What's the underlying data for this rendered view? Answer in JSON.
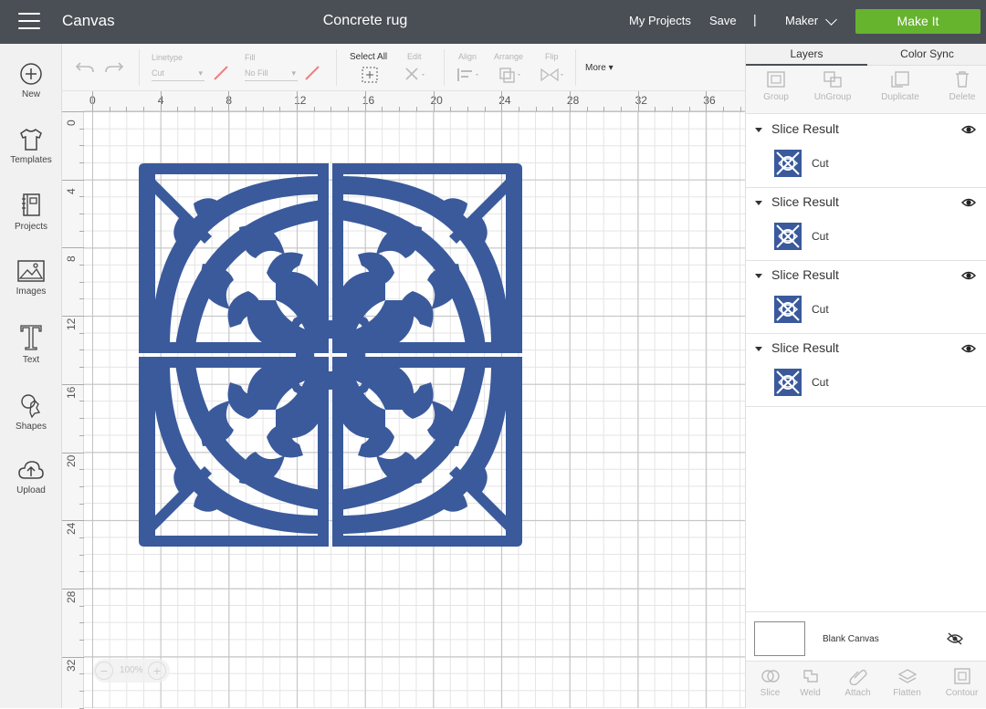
{
  "topbar": {
    "app_title": "Canvas",
    "doc_title": "Concrete rug",
    "my_projects": "My Projects",
    "save": "Save",
    "separator": "|",
    "machine": "Maker",
    "make_it": "Make It"
  },
  "sidebar": {
    "items": [
      {
        "label": "New",
        "icon": "plus-circle-icon"
      },
      {
        "label": "Templates",
        "icon": "tshirt-icon"
      },
      {
        "label": "Projects",
        "icon": "book-icon"
      },
      {
        "label": "Images",
        "icon": "image-icon"
      },
      {
        "label": "Text",
        "icon": "text-icon"
      },
      {
        "label": "Shapes",
        "icon": "shapes-icon"
      },
      {
        "label": "Upload",
        "icon": "cloud-upload-icon"
      }
    ]
  },
  "toolbar": {
    "linetype_label": "Linetype",
    "linetype_value": "Cut",
    "fill_label": "Fill",
    "fill_value": "No Fill",
    "select_all": "Select All",
    "edit": "Edit",
    "align": "Align",
    "arrange": "Arrange",
    "flip": "Flip",
    "more": "More"
  },
  "ruler": {
    "top": [
      "0",
      "4",
      "8",
      "12",
      "16",
      "20",
      "24",
      "28",
      "32",
      "36"
    ],
    "left": [
      "0",
      "4",
      "8",
      "12",
      "16",
      "20",
      "24",
      "28",
      "32"
    ]
  },
  "canvas": {
    "zoom": "100%",
    "design_color": "#3a5a9c"
  },
  "layers_panel": {
    "tabs": [
      "Layers",
      "Color Sync"
    ],
    "actions": [
      "Group",
      "UnGroup",
      "Duplicate",
      "Delete"
    ],
    "groups": [
      {
        "title": "Slice Result",
        "item": "Cut"
      },
      {
        "title": "Slice Result",
        "item": "Cut"
      },
      {
        "title": "Slice Result",
        "item": "Cut"
      },
      {
        "title": "Slice Result",
        "item": "Cut"
      }
    ],
    "blank_canvas": "Blank Canvas",
    "bottom_actions": [
      "Slice",
      "Weld",
      "Attach",
      "Flatten",
      "Contour"
    ]
  },
  "colors": {
    "topbar": "#4a4f55",
    "accent": "#66b32e",
    "design": "#3a5a9c"
  }
}
